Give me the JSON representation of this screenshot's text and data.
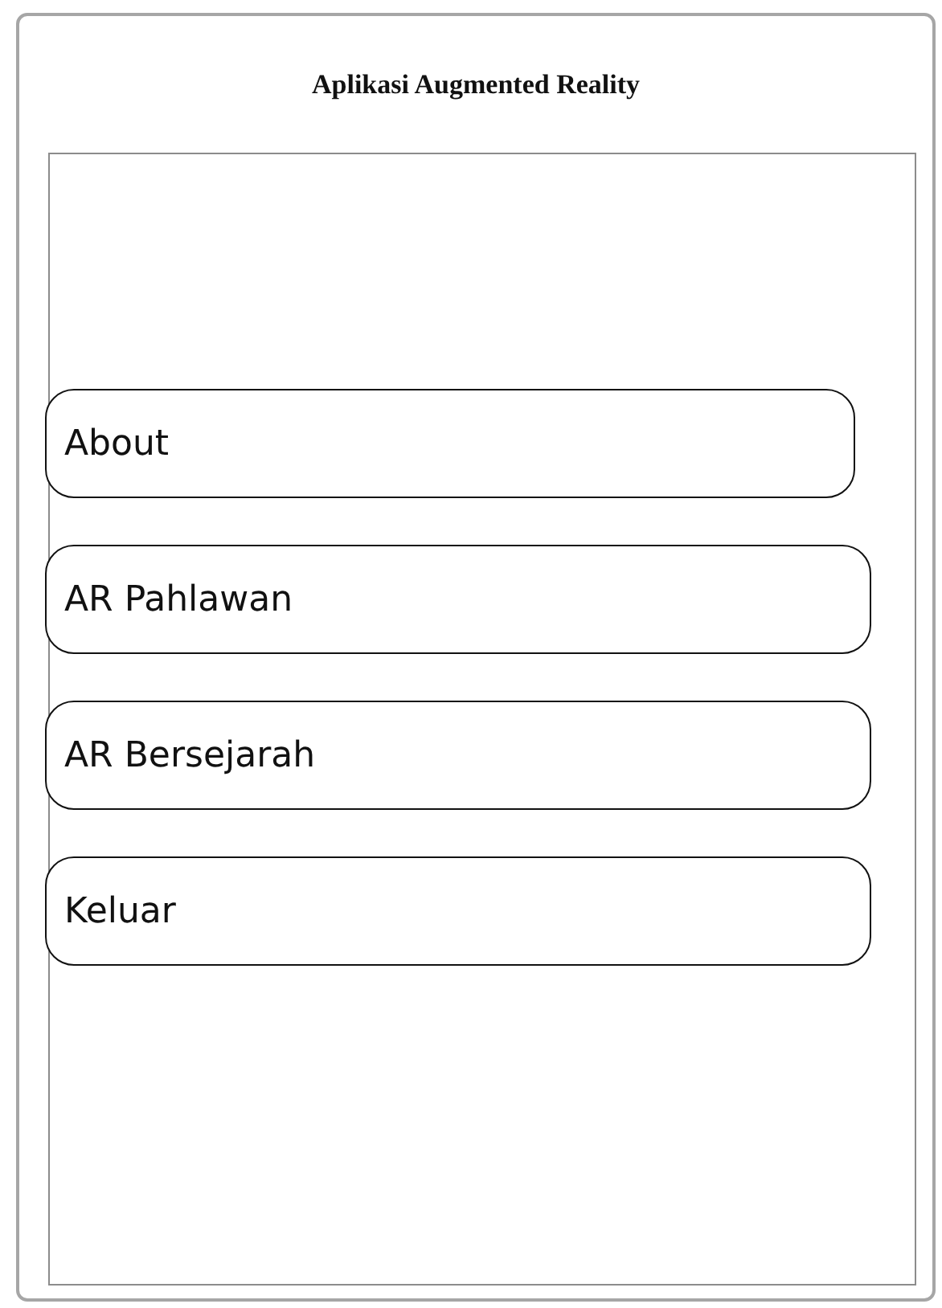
{
  "window": {
    "title": "Aplikasi Augmented Reality"
  },
  "menu": [
    {
      "label": "About"
    },
    {
      "label": "AR Pahlawan"
    },
    {
      "label": "AR Bersejarah"
    },
    {
      "label": "Keluar"
    }
  ]
}
